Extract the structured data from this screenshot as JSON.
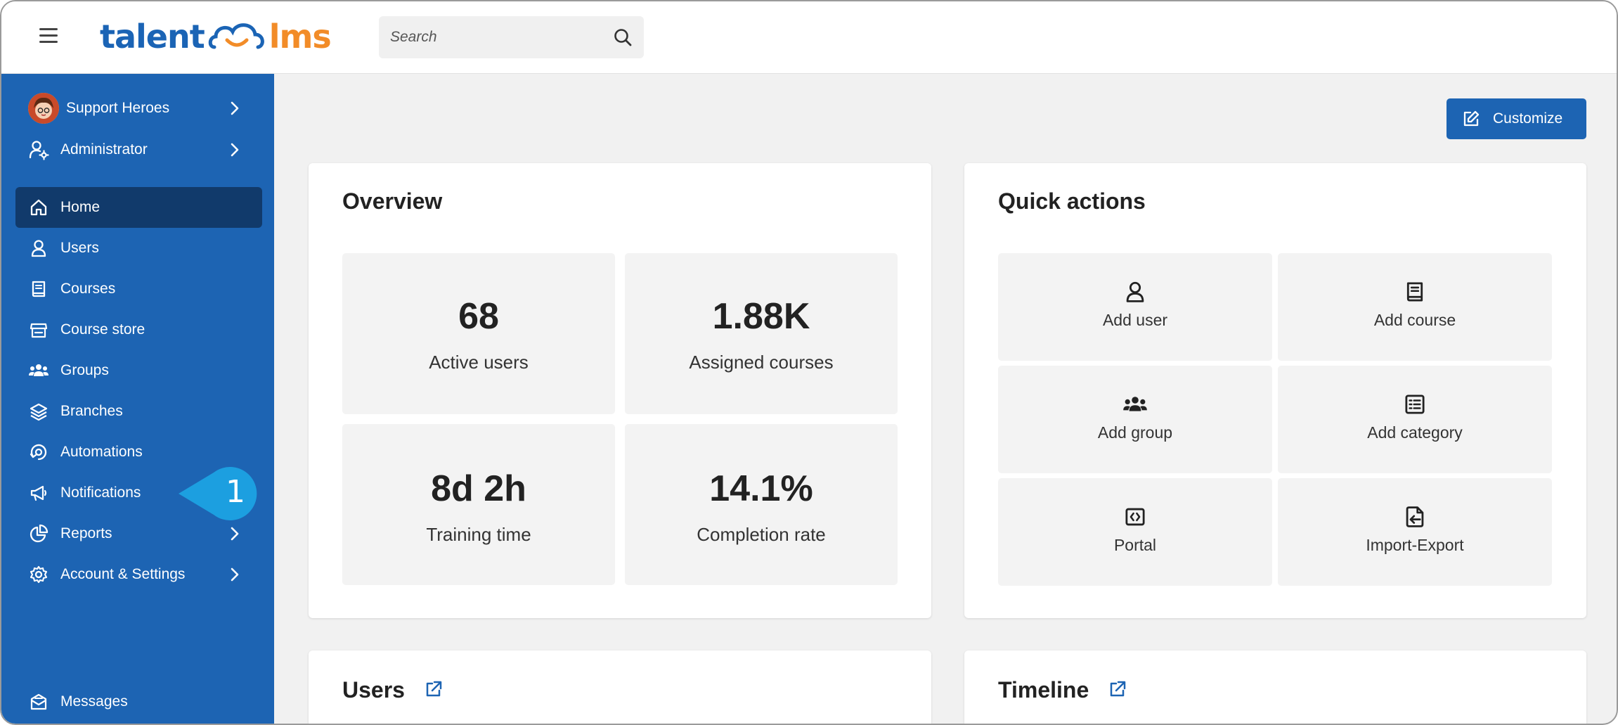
{
  "header": {
    "logo": {
      "left": "talent",
      "right": "lms"
    },
    "search_placeholder": "Search"
  },
  "sidebar": {
    "account": {
      "name": "Support Heroes"
    },
    "role": {
      "label": "Administrator"
    },
    "items": [
      {
        "label": "Home",
        "icon": "home-icon",
        "active": true
      },
      {
        "label": "Users",
        "icon": "user-icon"
      },
      {
        "label": "Courses",
        "icon": "book-icon"
      },
      {
        "label": "Course store",
        "icon": "store-icon"
      },
      {
        "label": "Groups",
        "icon": "groups-icon"
      },
      {
        "label": "Branches",
        "icon": "layers-icon"
      },
      {
        "label": "Automations",
        "icon": "automation-icon"
      },
      {
        "label": "Notifications",
        "icon": "megaphone-icon"
      },
      {
        "label": "Reports",
        "icon": "pie-chart-icon"
      },
      {
        "label": "Account & Settings",
        "icon": "gear-icon"
      }
    ],
    "messages": {
      "label": "Messages"
    },
    "callout_number": "1"
  },
  "main": {
    "customize_label": "Customize",
    "overview": {
      "title": "Overview",
      "stats": [
        {
          "value": "68",
          "label": "Active users"
        },
        {
          "value": "1.88K",
          "label": "Assigned courses"
        },
        {
          "value": "8d 2h",
          "label": "Training time"
        },
        {
          "value": "14.1%",
          "label": "Completion rate"
        }
      ]
    },
    "quick_actions": {
      "title": "Quick actions",
      "items": [
        {
          "label": "Add user",
          "icon": "user-icon"
        },
        {
          "label": "Add course",
          "icon": "book-icon"
        },
        {
          "label": "Add group",
          "icon": "groups-icon"
        },
        {
          "label": "Add category",
          "icon": "list-icon"
        },
        {
          "label": "Portal",
          "icon": "code-icon"
        },
        {
          "label": "Import-Export",
          "icon": "import-export-icon"
        }
      ]
    },
    "users_card": {
      "title": "Users"
    },
    "timeline_card": {
      "title": "Timeline"
    }
  },
  "colors": {
    "brand_blue": "#1d64b3",
    "active_nav": "#113a6b",
    "logo_orange": "#f28c28",
    "callout": "#1c9fe0"
  }
}
